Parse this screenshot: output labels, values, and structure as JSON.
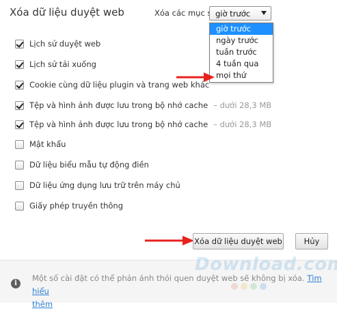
{
  "header": {
    "title": "Xóa dữ liệu duyệt web",
    "range_label": "Xóa các mục sau từ:",
    "range_select": {
      "value": "giờ trước",
      "options": [
        "giờ trước",
        "ngày trước",
        "tuần trước",
        "4 tuần qua",
        "mọi thứ"
      ],
      "highlighted": "giờ trước"
    }
  },
  "options": [
    {
      "label": "Lịch sử duyệt web",
      "checked": true,
      "size": ""
    },
    {
      "label": "Lịch sử tải xuống",
      "checked": true,
      "size": ""
    },
    {
      "label": "Cookie cùng dữ liệu plugin và trang web khác",
      "checked": true,
      "size": ""
    },
    {
      "label": "Tệp và hình ảnh được lưu trong bộ nhớ cache",
      "checked": true,
      "size": "–  dưới 28,3 MB"
    },
    {
      "label": "Tệp và hình ảnh được lưu trong bộ nhớ cache",
      "checked": true,
      "size": "–  dưới 28,3 MB"
    },
    {
      "label": "Mật khẩu",
      "checked": false,
      "size": ""
    },
    {
      "label": "Dữ liệu biểu mẫu tự động điền",
      "checked": false,
      "size": ""
    },
    {
      "label": "Dữ liệu ứng dụng lưu trữ trên máy chủ",
      "checked": false,
      "size": ""
    },
    {
      "label": "Giấy phép truyền thông",
      "checked": false,
      "size": ""
    }
  ],
  "buttons": {
    "clear": "Xóa dữ liệu duyệt web",
    "cancel": "Hủy"
  },
  "footer": {
    "text": "Một số cài đặt có thể phản ánh thói quen duyệt web sẽ không bị xóa.",
    "link_line1": "Tìm hiểu",
    "link_line2": "thêm"
  },
  "watermark": "Download.com.vn",
  "colors": {
    "selected_option": "#1e90ff",
    "annotation_arrow": "#e8211e",
    "link": "#2f7fd0"
  }
}
